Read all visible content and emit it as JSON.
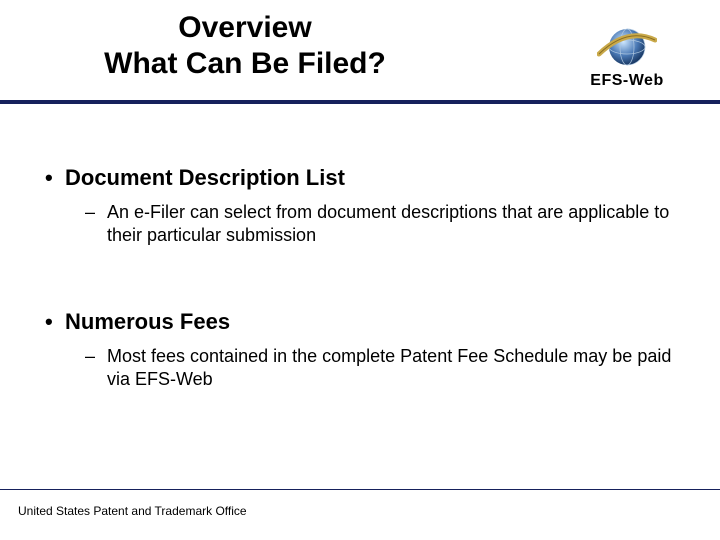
{
  "header": {
    "title_line1": "Overview",
    "title_line2": "What Can Be Filed?",
    "logo_text": "EFS-Web"
  },
  "content": {
    "b1": {
      "heading": "Document Description List",
      "sub": "An e-Filer can select from document descriptions that are applicable to their particular submission"
    },
    "b2": {
      "heading": "Numerous Fees",
      "sub": "Most fees contained in the complete Patent Fee Schedule may be paid via EFS-Web"
    }
  },
  "footer": {
    "text": "United States Patent and Trademark Office"
  },
  "colors": {
    "rule": "#16215c"
  }
}
